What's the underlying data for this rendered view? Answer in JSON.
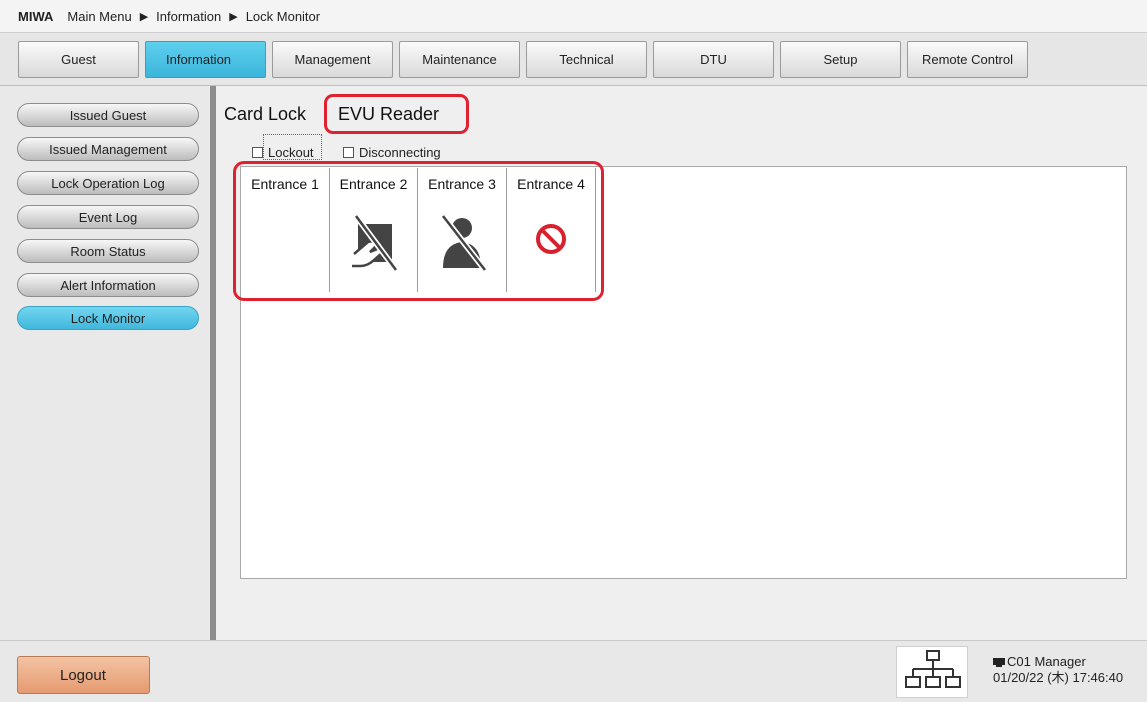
{
  "breadcrumb": {
    "brand": "MIWA",
    "items": [
      "Main Menu",
      "Information",
      "Lock Monitor"
    ],
    "separator": "▶"
  },
  "menu": {
    "tabs": [
      {
        "label": "Guest",
        "active": false
      },
      {
        "label": "Information",
        "active": true
      },
      {
        "label": "Management",
        "active": false
      },
      {
        "label": "Maintenance",
        "active": false
      },
      {
        "label": "Technical",
        "active": false
      },
      {
        "label": "DTU",
        "active": false
      },
      {
        "label": "Setup",
        "active": false
      },
      {
        "label": "Remote Control",
        "active": false
      }
    ]
  },
  "sidebar": {
    "items": [
      {
        "label": "Issued Guest",
        "active": false
      },
      {
        "label": "Issued Management",
        "active": false
      },
      {
        "label": "Lock Operation Log",
        "active": false
      },
      {
        "label": "Event Log",
        "active": false
      },
      {
        "label": "Room Status",
        "active": false
      },
      {
        "label": "Alert Information",
        "active": false
      },
      {
        "label": "Lock Monitor",
        "active": true
      }
    ]
  },
  "subtabs": {
    "card_lock": "Card Lock",
    "evu_reader": "EVU Reader"
  },
  "filters": {
    "lockout": {
      "label": "Lockout",
      "checked": false
    },
    "disconnecting": {
      "label": "Disconnecting",
      "checked": false
    }
  },
  "entrances": [
    {
      "label": "Entrance 1",
      "icon": "none"
    },
    {
      "label": "Entrance 2",
      "icon": "card-reader-disabled-icon"
    },
    {
      "label": "Entrance 3",
      "icon": "person-disabled-icon"
    },
    {
      "label": "Entrance 4",
      "icon": "prohibited-icon"
    }
  ],
  "footer": {
    "logout_label": "Logout",
    "terminal": "C01 Manager",
    "datetime": "01/20/22 (木) 17:46:40"
  },
  "colors": {
    "active_tab": "#3bb5dc",
    "highlight": "#e0212f",
    "logout": "#e59a70"
  }
}
